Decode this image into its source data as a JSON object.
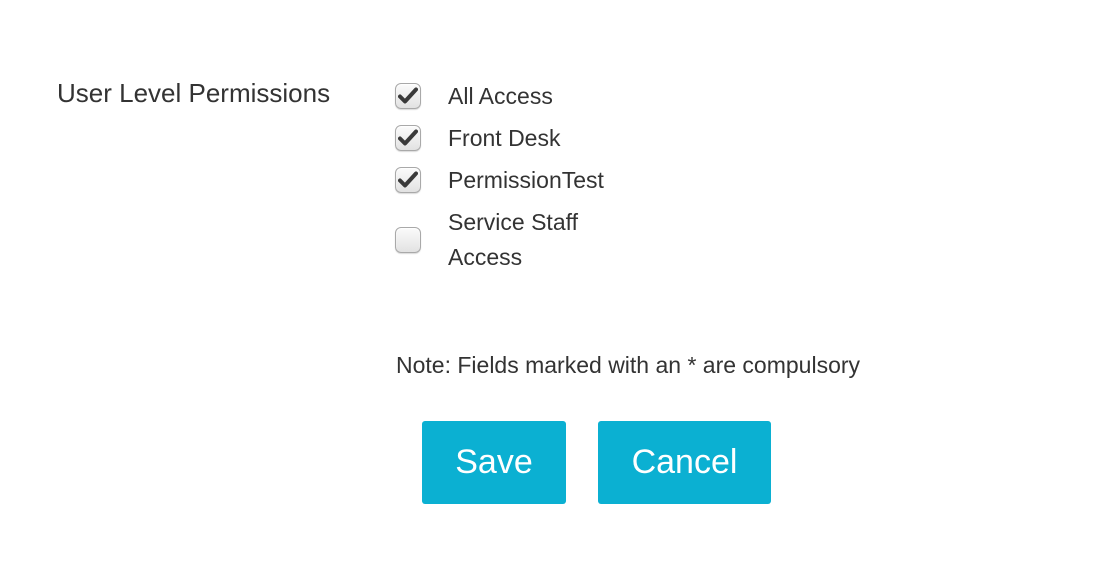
{
  "form": {
    "field_label": "User Level Permissions",
    "permissions": [
      {
        "label": "All Access",
        "checked": true
      },
      {
        "label": "Front Desk",
        "checked": true
      },
      {
        "label": "PermissionTest",
        "checked": true
      },
      {
        "label": "Service Staff Access",
        "checked": false
      }
    ],
    "note": "Note: Fields marked with an * are compulsory",
    "save_label": "Save",
    "cancel_label": "Cancel"
  },
  "icons": {
    "checkmark": "checkmark-icon"
  },
  "colors": {
    "button_bg": "#0bb0d2",
    "button_text": "#ffffff",
    "text": "#333333"
  }
}
